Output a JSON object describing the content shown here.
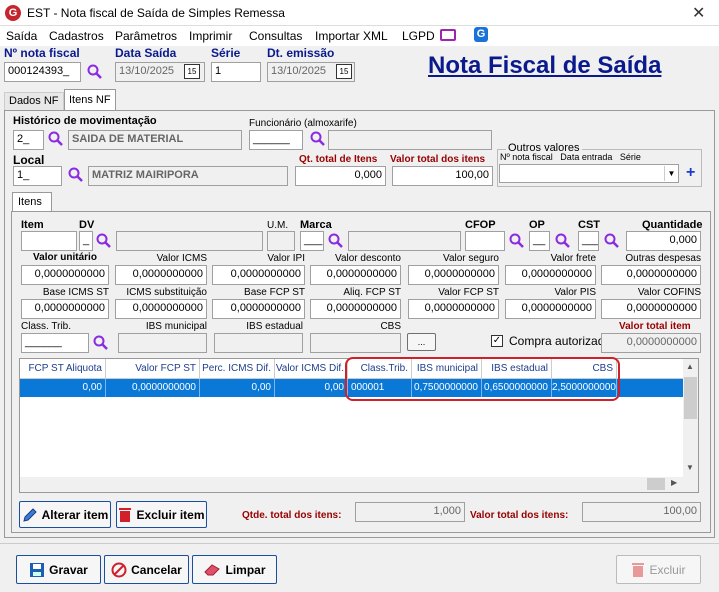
{
  "window": {
    "title": "EST - Nota fiscal de Saída de Simples Remessa",
    "app_icon": "G"
  },
  "menu": [
    "Saída",
    "Cadastros",
    "Parâmetros",
    "Imprimir",
    "Consultas",
    "Importar XML",
    "LGPD"
  ],
  "header": {
    "nf_label": "Nº nota fiscal",
    "nf_value": "000124393_",
    "data_saida_label": "Data Saída",
    "data_saida_value": "13/10/2025",
    "serie_label": "Série",
    "serie_value": "1",
    "dt_emissao_label": "Dt. emissão",
    "dt_emissao_value": "13/10/2025",
    "big_title": "Nota Fiscal de Saída"
  },
  "tabs": [
    "Dados NF",
    "Itens NF"
  ],
  "itens_nf": {
    "historico_label": "Histórico de movimentação",
    "historico_code": "2_",
    "historico_desc": "SAIDA DE MATERIAL",
    "funcionario_label": "Funcionário (almoxarife)",
    "funcionario_code": "______",
    "local_label": "Local",
    "local_code": "1_",
    "local_desc": "MATRIZ MAIRIPORA",
    "qt_total_label": "Qt. total de Itens",
    "qt_total_value": "0,000",
    "valor_total_label": "Valor total dos itens",
    "valor_total_value": "100,00",
    "outros_label": "Outros valores",
    "outros_cols": "Nº nota fiscal   Data entrada   Série"
  },
  "itens_tab": "Itens",
  "item_fields": {
    "item": "Item",
    "dv": "DV",
    "um": "U.M.",
    "marca": "Marca",
    "cfop": "CFOP",
    "op": "OP",
    "cst": "CST",
    "quantidade": "Quantidade",
    "quantidade_value": "0,000",
    "dv_value": "_",
    "marca_value": "___",
    "op_value": "__",
    "cst_value": "___"
  },
  "row2": [
    {
      "label": "Valor unitário",
      "value": "0,0000000000"
    },
    {
      "label": "Valor ICMS",
      "value": "0,0000000000"
    },
    {
      "label": "Valor IPI",
      "value": "0,0000000000"
    },
    {
      "label": "Valor desconto",
      "value": "0,0000000000"
    },
    {
      "label": "Valor seguro",
      "value": "0,0000000000"
    },
    {
      "label": "Valor frete",
      "value": "0,0000000000"
    },
    {
      "label": "Outras despesas",
      "value": "0,0000000000"
    }
  ],
  "row3": [
    {
      "label": "Base ICMS ST",
      "value": "0,0000000000"
    },
    {
      "label": "ICMS substituição",
      "value": "0,0000000000"
    },
    {
      "label": "Base FCP ST",
      "value": "0,0000000000"
    },
    {
      "label": "Aliq. FCP ST",
      "value": "0,0000000000"
    },
    {
      "label": "Valor FCP ST",
      "value": "0,0000000000"
    },
    {
      "label": "Valor PIS",
      "value": "0,0000000000"
    },
    {
      "label": "Valor COFINS",
      "value": "0,0000000000"
    }
  ],
  "row4": {
    "class_trib_label": "Class. Trib.",
    "class_trib_value": "______",
    "ibs_mun_label": "IBS municipal",
    "ibs_est_label": "IBS estadual",
    "cbs_label": "CBS",
    "ellipsis": "...",
    "compra_label": "Compra autorizada",
    "valor_total_item_label": "Valor total item",
    "valor_total_item_value": "0,0000000000"
  },
  "grid": {
    "headers": [
      "FCP ST Aliquota",
      "Valor FCP ST",
      "Perc. ICMS Dif.",
      "Valor ICMS Dif.",
      "Class.Trib.",
      "IBS municipal",
      "IBS estadual",
      "CBS"
    ],
    "row": [
      "0,00",
      "0,0000000000",
      "0,00",
      "0,00",
      "000001",
      "0,7500000000",
      "0,6500000000",
      "2,5000000000"
    ]
  },
  "footer": {
    "alterar": "Alterar item",
    "excluir_item": "Excluir item",
    "qtde_label": "Qtde. total dos itens:",
    "qtde_value": "1,000",
    "valor_label": "Valor total dos itens:",
    "valor_value": "100,00"
  },
  "bottom": {
    "gravar": "Gravar",
    "cancelar": "Cancelar",
    "limpar": "Limpar",
    "excluir": "Excluir"
  },
  "colors": {
    "accent_red": "#990000",
    "title_blue": "#0a1a8c",
    "selection": "#0a78d7",
    "highlight_ring": "#d0202a"
  }
}
